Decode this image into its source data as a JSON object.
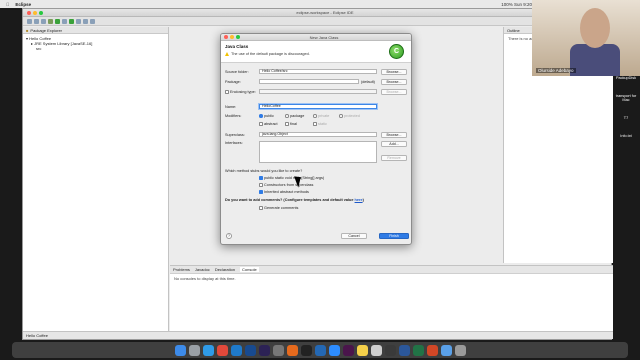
{
  "menubar": {
    "app_name": "Eclipse",
    "clock": "100% Sun 9:20 PM"
  },
  "window": {
    "title": "eclipse-workspace - Eclipse IDE"
  },
  "package_explorer": {
    "tab_label": "Package Explorer",
    "items": [
      "Hello Coffee",
      "JRE System Library [JavaSE-16]",
      "src"
    ]
  },
  "outline": {
    "tab_label": "Outline",
    "message": "There is no active"
  },
  "bottom": {
    "tabs": [
      "Problems",
      "Javadoc",
      "Declaration",
      "Console"
    ],
    "message": "No consoles to display at this time."
  },
  "statusbar": {
    "text": "Hello Coffee"
  },
  "dialog": {
    "title": "New Java Class",
    "heading": "Java Class",
    "warning": "The use of the default package is discouraged.",
    "source_folder_label": "Source folder:",
    "source_folder_value": "Hello Coffee/src",
    "package_label": "Package:",
    "package_value": "",
    "package_default": "(default)",
    "enclosing_label": "Enclosing type:",
    "name_label": "Name:",
    "name_value": "HelloCoffee",
    "modifiers_label": "Modifiers:",
    "mod_public": "public",
    "mod_package": "package",
    "mod_private": "private",
    "mod_protected": "protected",
    "mod_abstract": "abstract",
    "mod_final": "final",
    "mod_static": "static",
    "superclass_label": "Superclass:",
    "superclass_value": "java.lang.Object",
    "interfaces_label": "Interfaces:",
    "browse": "Browse...",
    "add": "Add...",
    "remove": "Remove",
    "stubs_question": "Which method stubs would you like to create?",
    "stub_main": "public static void main(String[] args)",
    "stub_constructors": "Constructors from superclass",
    "stub_inherited": "Inherited abstract methods",
    "comments_question": "Do you want to add comments? (Configure templates and default value",
    "comments_link": "here",
    "comments_end": ")",
    "generate_comments": "Generate comments",
    "cancel": "Cancel",
    "finish": "Finish"
  },
  "webcam": {
    "name": "Olurside Adebayo"
  },
  "desktop": {
    "files": [
      "PackupDisk",
      "transport for Mac",
      "T7",
      "Info.txt"
    ]
  }
}
